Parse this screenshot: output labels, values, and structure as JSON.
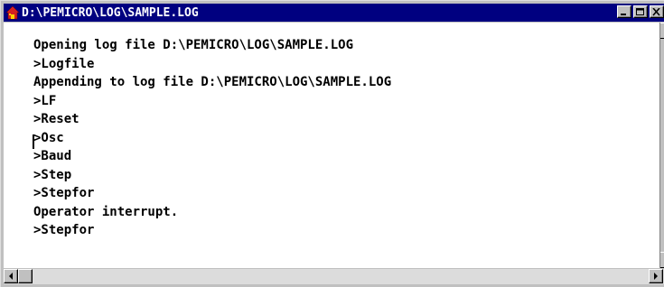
{
  "window": {
    "title": "D:\\PEMICRO\\LOG\\SAMPLE.LOG",
    "icon": "house-icon",
    "titlebar_color": "#000080"
  },
  "log": {
    "lines": [
      "Opening log file D:\\PEMICRO\\LOG\\SAMPLE.LOG",
      ">Logfile",
      "Appending to log file D:\\PEMICRO\\LOG\\SAMPLE.LOG",
      ">LF",
      ">Reset",
      ">Osc",
      ">Baud",
      ">Step",
      ">Stepfor",
      "Operator interrupt.",
      ">Stepfor"
    ]
  }
}
